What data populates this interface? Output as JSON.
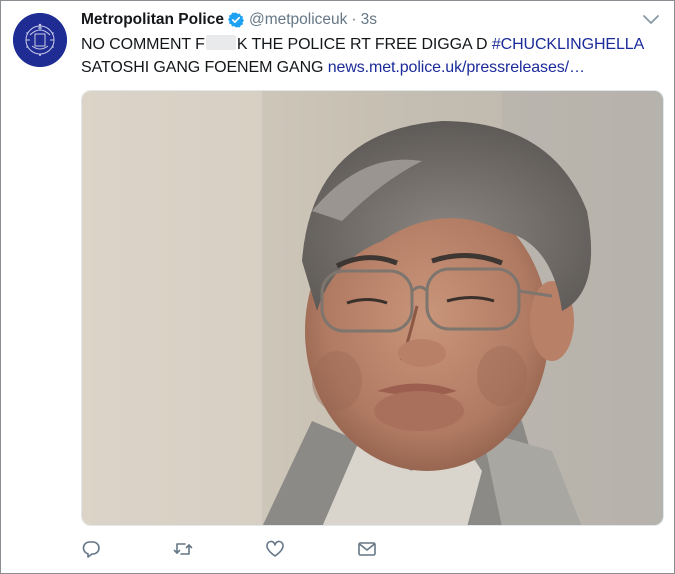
{
  "tweet": {
    "display_name": "Metropolitan Police",
    "handle": "@metpoliceuk",
    "separator": "·",
    "timestamp": "3s",
    "text_line1_part1": "NO COMMENT F",
    "text_line1_part2": "K THE POLICE RT FREE DIGGA D",
    "hashtag": "#CHUCKLINGHELLA",
    "text_line2": "SATOSHI GANG FOENEM GANG",
    "link_text": "news.met.police.uk/pressreleases/…"
  },
  "icons": {
    "verified": "verified-badge-icon",
    "caret": "chevron-down-icon",
    "reply": "reply-icon",
    "retweet": "retweet-icon",
    "like": "heart-icon",
    "dm": "envelope-icon"
  },
  "colors": {
    "link": "#1b2b9a",
    "verified": "#1da1f2",
    "muted": "#657786",
    "avatar_bg": "#1f2c94"
  }
}
